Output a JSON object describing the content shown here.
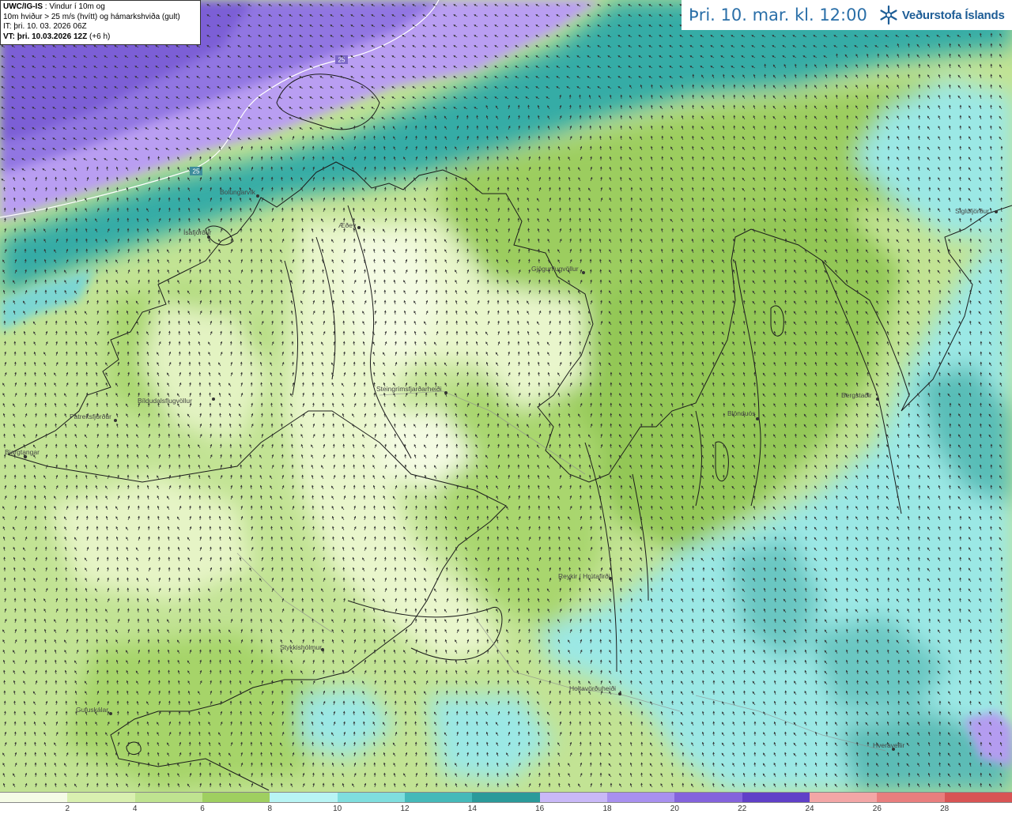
{
  "info": {
    "model": "UWC/IG-IS",
    "line1_rest": ": Vindur í 10m og",
    "line2": "10m hviður > 25 m/s (hvítt) og hámarkshviða (gult)",
    "it": "IT: þri. 10. 03. 2026 06Z",
    "vt_bold": "VT: þri. 10.03.2026 12Z",
    "vt_offset": "(+6 h)"
  },
  "header": {
    "valid_time": "Þri. 10. mar. kl. 12:00",
    "brand": "Veðurstofa Íslands",
    "brand_icon": "snowflake-logo-icon"
  },
  "isoline_label": "25",
  "places": [
    {
      "name": "Bolungarvík"
    },
    {
      "name": "Ísafjörður"
    },
    {
      "name": "Æðey"
    },
    {
      "name": "Gjögurflugvöllur"
    },
    {
      "name": "Siglufjörður"
    },
    {
      "name": "Þingeyri"
    },
    {
      "name": "Bíldudalsflugvöllur"
    },
    {
      "name": "Patreksfjörður"
    },
    {
      "name": "Bjargtangar"
    },
    {
      "name": "Steingrímsfjarðarheiði"
    },
    {
      "name": "Blönduós"
    },
    {
      "name": "Bergstaðir"
    },
    {
      "name": "Reykir í Hrútafirði"
    },
    {
      "name": "Stykkishólmur"
    },
    {
      "name": "Holtavörðuheiði"
    },
    {
      "name": "Gufuskálar"
    },
    {
      "name": "Hveravellir"
    }
  ],
  "legend": {
    "unit": "m/s",
    "ticks": [
      "2",
      "4",
      "6",
      "8",
      "10",
      "12",
      "14",
      "16",
      "18",
      "20",
      "22",
      "24",
      "26",
      "28"
    ],
    "colors": [
      "#f5fbe6",
      "#d9f0b0",
      "#bfe390",
      "#9fcf60",
      "#b8f4f4",
      "#7fdede",
      "#45b9b9",
      "#2a9a9a",
      "#c9b8f7",
      "#a890ef",
      "#8463dc",
      "#6040c8",
      "#f3a6a6",
      "#e97e7e",
      "#d85454"
    ]
  },
  "colors": {
    "title_text": "#2a6fa8",
    "brand_text": "#1d5d96",
    "coastline": "#1a1a1a",
    "arrows": "#333333"
  }
}
